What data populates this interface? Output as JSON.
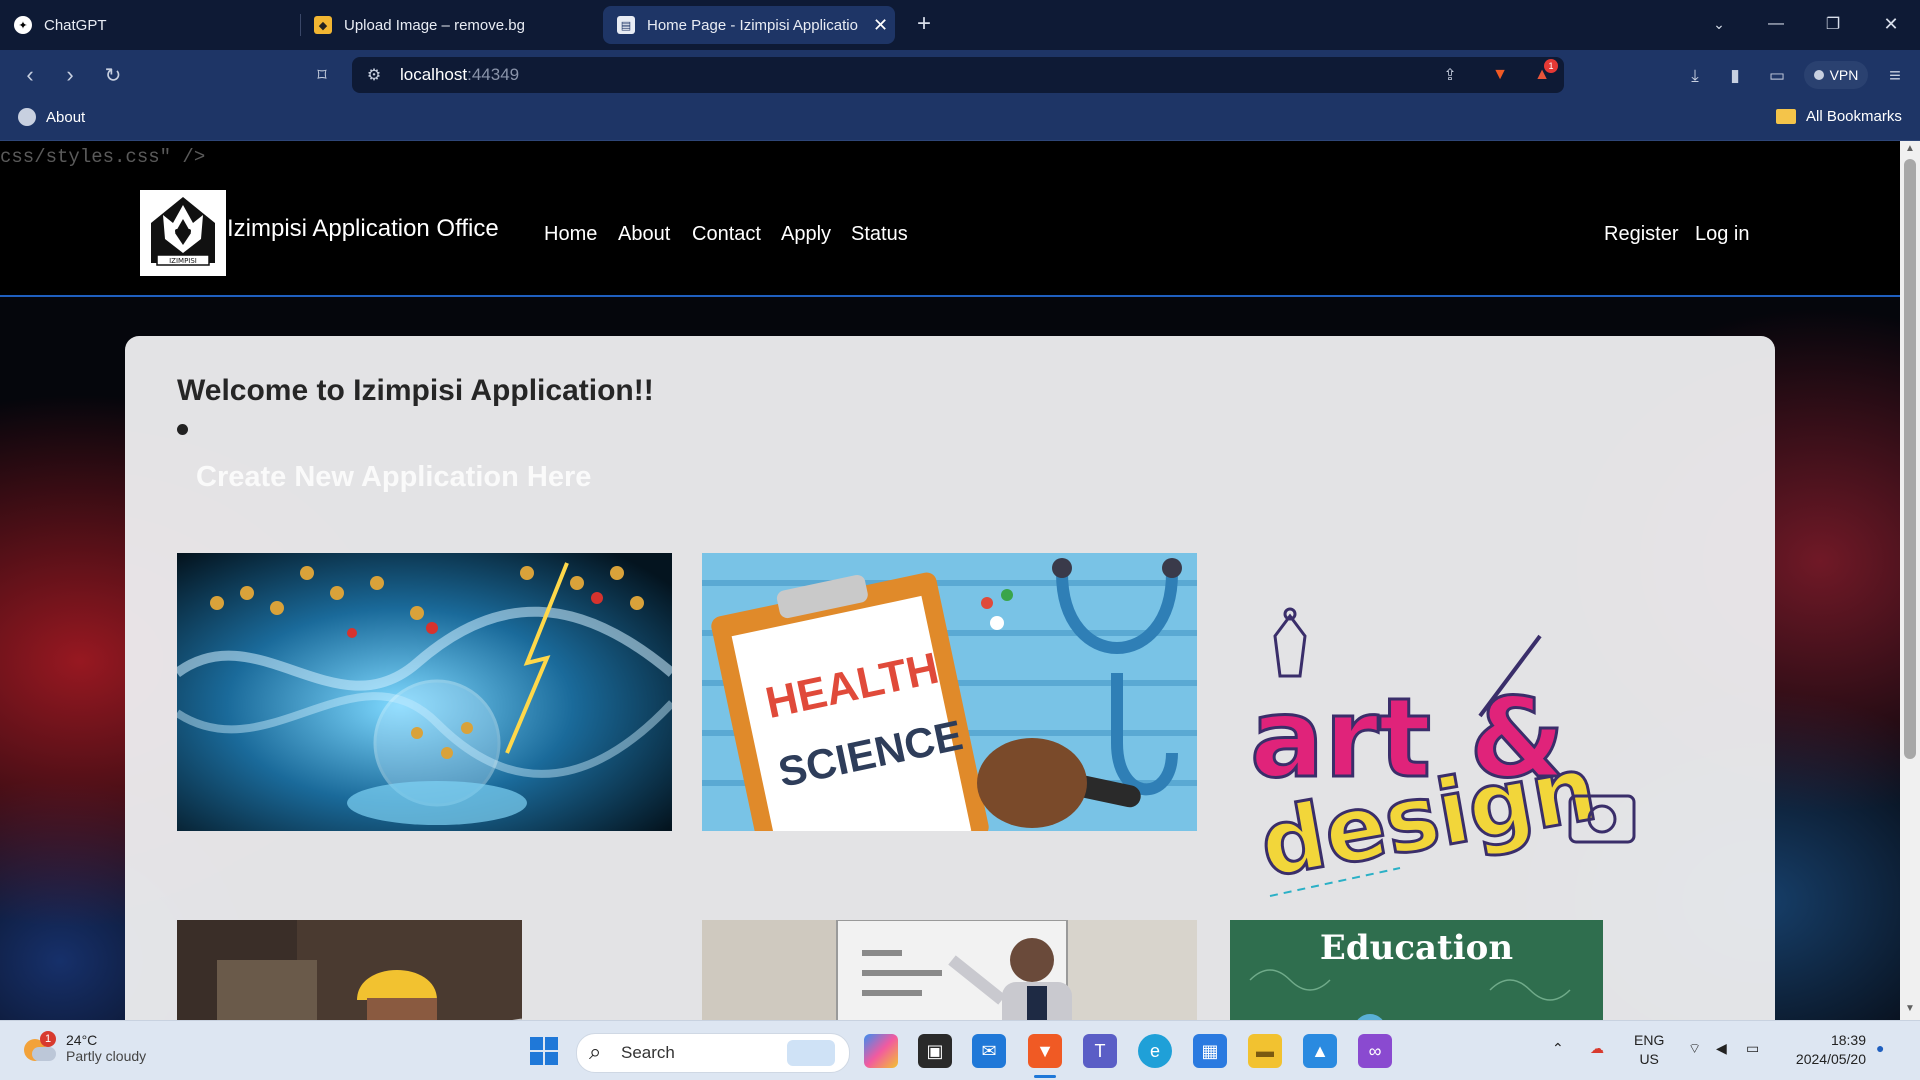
{
  "browser": {
    "tabs": [
      {
        "title": "ChatGPT",
        "active": false
      },
      {
        "title": "Upload Image – remove.bg",
        "active": false
      },
      {
        "title": "Home Page - Izimpisi Applicatio",
        "active": true
      }
    ],
    "url_host": "localhost",
    "url_port": ":44349",
    "vpn_label": "VPN",
    "notification_count": "1",
    "bookmarks": {
      "left_item": "About",
      "right_item": "All Bookmarks"
    }
  },
  "page": {
    "source_leak": "css/styles.css\" />",
    "brand": "Izimpisi Application Office",
    "logo_text": "IZIMPISI",
    "nav": [
      "Home",
      "About",
      "Contact",
      "Apply",
      "Status"
    ],
    "auth": [
      "Register",
      "Log in"
    ],
    "welcome": "Welcome to Izimpisi Application!!",
    "create_link": "Create New Application Here",
    "tiles": [
      {
        "name": "science",
        "text": ""
      },
      {
        "name": "health-science",
        "line1": "HEALTH",
        "line2": "SCIENCE"
      },
      {
        "name": "art-design",
        "line1": "art &",
        "line2": "design"
      },
      {
        "name": "engineering",
        "text": ""
      },
      {
        "name": "business",
        "text": ""
      },
      {
        "name": "education",
        "text": "Education"
      }
    ]
  },
  "taskbar": {
    "weather_temp": "24°C",
    "weather_desc": "Partly cloudy",
    "weather_badge": "1",
    "search_label": "Search",
    "lang_line1": "ENG",
    "lang_line2": "US",
    "time": "18:39",
    "date": "2024/05/20"
  }
}
